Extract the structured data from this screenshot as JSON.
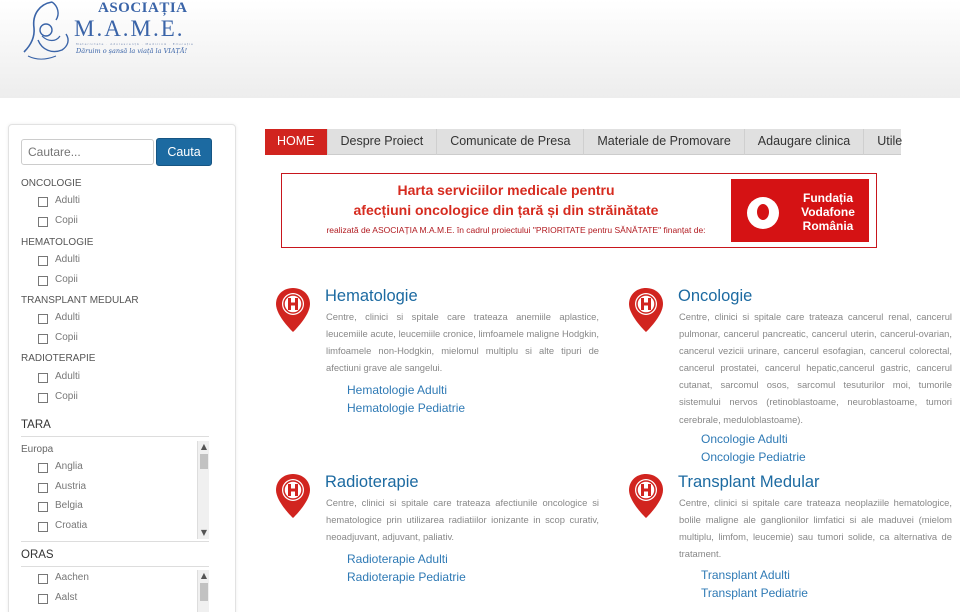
{
  "header": {
    "logo_title": "ASOCIAȚIA",
    "logo_name": "M.A.M.E.",
    "logo_subtitle": "Maternitate · Adolescență · Medicină · Educație",
    "logo_motto": "Dăruim o șansă la viață la VIAȚĂ!"
  },
  "sidebar": {
    "search": {
      "placeholder": "Cautare...",
      "button": "Cauta"
    },
    "categories": [
      {
        "title": "ONCOLOGIE",
        "options": [
          "Adulti",
          "Copii"
        ]
      },
      {
        "title": "HEMATOLOGIE",
        "options": [
          "Adulti",
          "Copii"
        ]
      },
      {
        "title": "TRANSPLANT MEDULAR",
        "options": [
          "Adulti",
          "Copii"
        ]
      },
      {
        "title": "RADIOTERAPIE",
        "options": [
          "Adulti",
          "Copii"
        ]
      }
    ],
    "tara": {
      "title": "TARA",
      "region": "Europa",
      "items": [
        "Anglia",
        "Austria",
        "Belgia",
        "Croatia"
      ]
    },
    "oras": {
      "title": "ORAS",
      "items": [
        "Aachen",
        "Aalst"
      ]
    }
  },
  "nav": {
    "items": [
      "HOME",
      "Despre Proiect",
      "Comunicate de Presa",
      "Materiale de Promovare",
      "Adaugare clinica",
      "Utile"
    ],
    "active": "HOME"
  },
  "banner": {
    "title_line1": "Harta serviciilor medicale pentru",
    "title_line2": "afecțiuni oncologice din țară și din străinătate",
    "subtitle": "realizată de ASOCIAȚIA M.A.M.E. în cadrul proiectului \"PRIORITATE pentru SĂNĂTATE\" finanțat de:",
    "sponsor_line1": "Fundația",
    "sponsor_line2": "Vodafone",
    "sponsor_line3": "România"
  },
  "services": [
    {
      "title": "Hematologie",
      "description": "Centre, clinici si spitale care trateaza anemiile aplastice, leucemiile acute, leucemiile cronice, limfoamele maligne Hodgkin, limfoamele non-Hodgkin, mielomul multiplu si alte tipuri de afectiuni grave ale sangelui.",
      "links": [
        "Hematologie Adulti",
        "Hematologie Pediatrie"
      ]
    },
    {
      "title": "Oncologie",
      "description": "Centre, clinici si spitale care trateaza cancerul renal, cancerul pulmonar, cancerul pancreatic, cancerul uterin, cancerul-ovarian, cancerul vezicii urinare, cancerul esofagian, cancerul colorectal, cancerul prostatei, cancerul hepatic,cancerul gastric, cancerul cutanat, sarcomul osos, sarcomul tesuturilor moi, tumorile sistemului nervos (retinoblastoame, neuroblastoame, tumori cerebrale, meduloblastoame).",
      "links": [
        "Oncologie Adulti",
        "Oncologie Pediatrie"
      ]
    },
    {
      "title": "Radioterapie",
      "description": "Centre, clinici si spitale care trateaza afectiunile oncologice si hematologice prin utilizarea radiatiilor ionizante in scop curativ, neoadjuvant, adjuvant, paliativ.",
      "links": [
        "Radioterapie Adulti",
        "Radioterapie Pediatrie"
      ]
    },
    {
      "title": "Transplant Medular",
      "description": "Centre, clinici si spitale care trateaza neoplaziile hematologice, bolile maligne ale ganglionilor limfatici si ale maduvei (mielom multiplu, limfom, leucemie) sau tumori solide, ca alternativa de tratament.",
      "links": [
        "Transplant Adulti",
        "Transplant Pediatrie"
      ]
    }
  ],
  "colors": {
    "accent_red": "#d1241f",
    "link_blue": "#1c6aa1",
    "nav_bg": "#e0e0e0"
  }
}
